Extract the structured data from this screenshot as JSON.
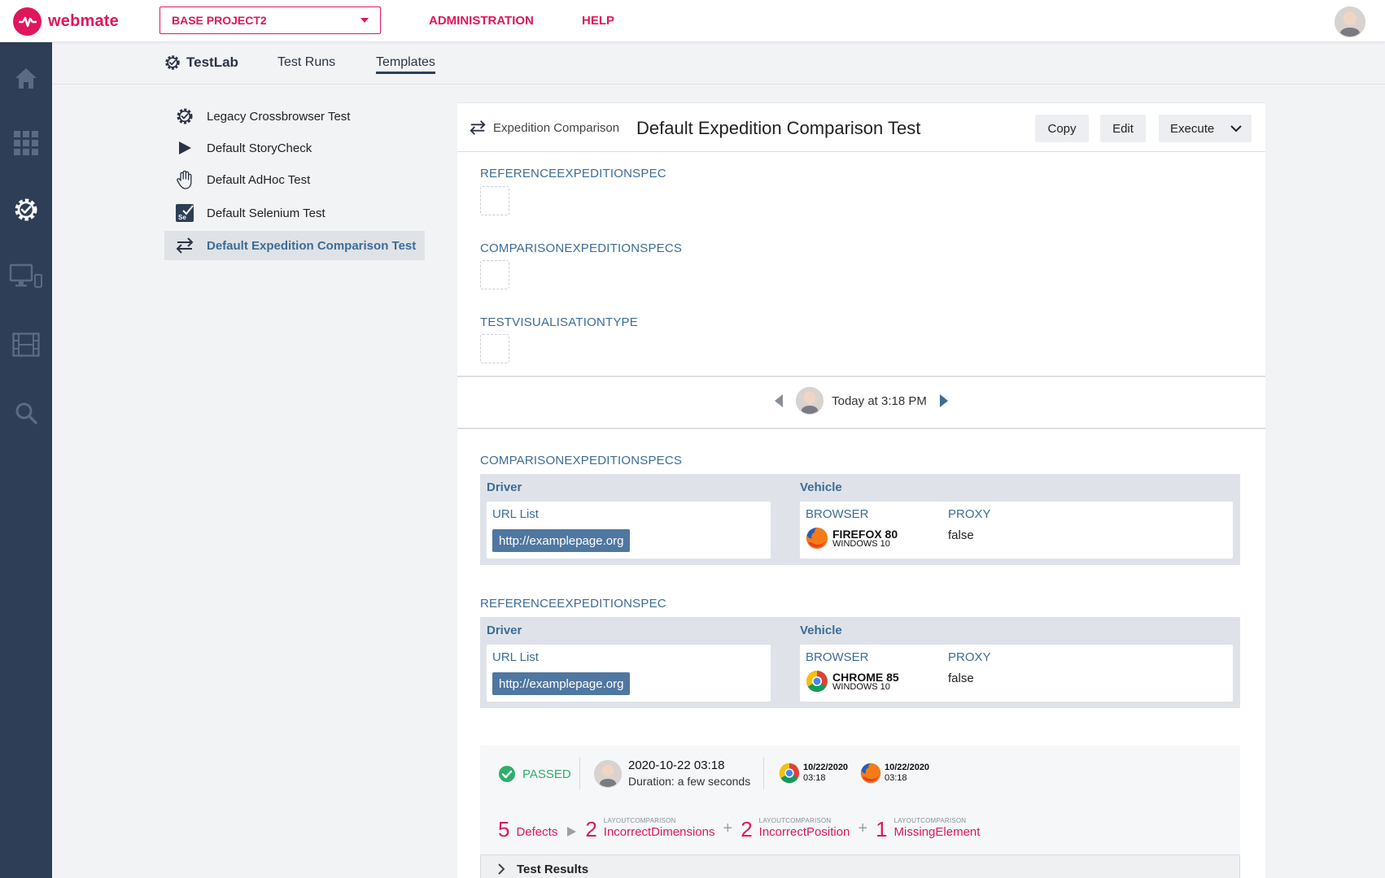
{
  "brand": {
    "name": "webmate",
    "color": "#e0165d"
  },
  "header": {
    "project": "BASE PROJECT2",
    "nav": [
      "ADMINISTRATION",
      "HELP"
    ]
  },
  "sidebar": {
    "icons": [
      "home-icon",
      "apps-grid-icon",
      "testlab-gear-icon",
      "devices-icon",
      "film-icon",
      "search-icon"
    ]
  },
  "subnav": {
    "section": "TestLab",
    "tabs": [
      "Test Runs",
      "Templates"
    ],
    "active_tab": "Templates"
  },
  "templates": [
    {
      "label": "Legacy Crossbrowser Test",
      "icon": "gear-check-icon"
    },
    {
      "label": "Default StoryCheck",
      "icon": "play-icon"
    },
    {
      "label": "Default AdHoc Test",
      "icon": "hand-icon"
    },
    {
      "label": "Default Selenium Test",
      "icon": "selenium-icon"
    },
    {
      "label": "Default Expedition Comparison Test",
      "icon": "compare-arrows-icon",
      "active": true
    }
  ],
  "detail": {
    "type_label": "Expedition Comparison",
    "title": "Default Expedition Comparison Test",
    "buttons": {
      "copy": "Copy",
      "edit": "Edit",
      "execute": "Execute"
    },
    "params": [
      "REFERENCEEXPEDITIONSPEC",
      "COMPARISONEXPEDITIONSPECS",
      "TESTVISUALISATIONTYPE"
    ],
    "history_time": "Today at 3:18 PM"
  },
  "specs": [
    {
      "label": "COMPARISONEXPEDITIONSPECS",
      "driver_head": "Driver",
      "vehicle_head": "Vehicle",
      "url_list_label": "URL List",
      "url": "http://examplepage.org",
      "browser_label": "BROWSER",
      "browser_name": "FIREFOX 80",
      "browser_os": "WINDOWS 10",
      "browser_icon": "firefox-icon",
      "proxy_label": "PROXY",
      "proxy": "false"
    },
    {
      "label": "REFERENCEEXPEDITIONSPEC",
      "driver_head": "Driver",
      "vehicle_head": "Vehicle",
      "url_list_label": "URL List",
      "url": "http://examplepage.org",
      "browser_label": "BROWSER",
      "browser_name": "CHROME 85",
      "browser_os": "WINDOWS 10",
      "browser_icon": "chrome-icon",
      "proxy_label": "PROXY",
      "proxy": "false"
    }
  ],
  "result": {
    "status": "PASSED",
    "date": "2020-10-22 03:18",
    "duration": "Duration: a few seconds",
    "browsers": [
      {
        "icon": "chrome-icon",
        "date": "10/22/2020",
        "time": "03:18"
      },
      {
        "icon": "firefox-icon",
        "date": "10/22/2020",
        "time": "03:18"
      }
    ],
    "defects_count": "5",
    "defects_label": "Defects",
    "defects": [
      {
        "kind": "LAYOUTCOMPARISON",
        "count": "2",
        "name": "IncorrectDimensions"
      },
      {
        "kind": "LAYOUTCOMPARISON",
        "count": "2",
        "name": "IncorrectPosition"
      },
      {
        "kind": "LAYOUTCOMPARISON",
        "count": "1",
        "name": "MissingElement"
      }
    ],
    "test_results_label": "Test Results"
  },
  "colors": {
    "accent": "#e0165d",
    "sidebar": "#2d3e56",
    "label_blue": "#3d6c96",
    "chip": "#4f77a0",
    "passed": "#2fae6a"
  }
}
